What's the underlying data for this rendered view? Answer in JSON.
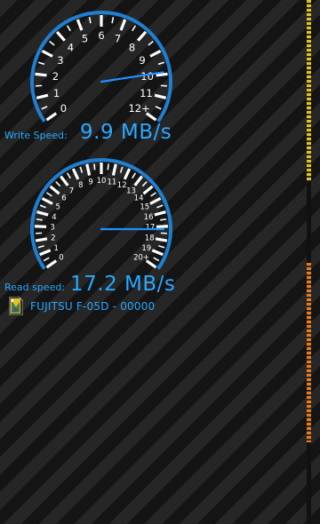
{
  "write": {
    "label": "Write Speed:",
    "value_text": "9.9 MB/s",
    "speed": 9.9,
    "ticks": [
      "0",
      "1",
      "2",
      "3",
      "4",
      "5",
      "6",
      "7",
      "8",
      "9",
      "10",
      "11",
      "12+"
    ],
    "max": 12
  },
  "read": {
    "label": "Read speed:",
    "value_text": "17.2 MB/s",
    "speed": 17.2,
    "ticks": [
      "0",
      "1",
      "2",
      "3",
      "4",
      "5",
      "6",
      "7",
      "8",
      "9",
      "10",
      "11",
      "12",
      "13",
      "14",
      "15",
      "16",
      "17",
      "18",
      "19",
      "20+"
    ],
    "max": 20
  },
  "device": {
    "name": "FUJITSU F-05D - 00000",
    "icon": "sd-card-icon"
  },
  "colors": {
    "accent": "#29a8ff",
    "ring": "#1f7fd0",
    "needle": "#1e90ff",
    "scroll_top": "#e8c21a",
    "scroll_mid": "#f07a16"
  }
}
